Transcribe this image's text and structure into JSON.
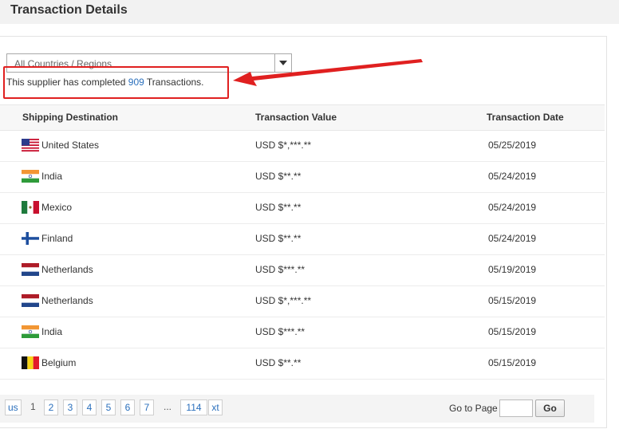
{
  "header": {
    "title": "Transaction Details"
  },
  "filter": {
    "selected": "All Countries / Regions"
  },
  "summary": {
    "prefix": "This supplier has completed",
    "count": "909",
    "suffix": "Transactions."
  },
  "table": {
    "columns": [
      "Shipping Destination",
      "Transaction Value",
      "Transaction Date"
    ],
    "rows": [
      {
        "flag": "us-flag-icon",
        "country": "United States",
        "value": "USD $*,***.**",
        "date": "05/25/2019"
      },
      {
        "flag": "india-flag-icon",
        "country": "India",
        "value": "USD $**.**",
        "date": "05/24/2019"
      },
      {
        "flag": "mexico-flag-icon",
        "country": "Mexico",
        "value": "USD $**.**",
        "date": "05/24/2019"
      },
      {
        "flag": "finland-flag-icon",
        "country": "Finland",
        "value": "USD $**.**",
        "date": "05/24/2019"
      },
      {
        "flag": "netherlands-flag-icon",
        "country": "Netherlands",
        "value": "USD $***.**",
        "date": "05/19/2019"
      },
      {
        "flag": "netherlands-flag-icon",
        "country": "Netherlands",
        "value": "USD $*,***.**",
        "date": "05/15/2019"
      },
      {
        "flag": "india-flag-icon",
        "country": "India",
        "value": "USD $***.**",
        "date": "05/15/2019"
      },
      {
        "flag": "belgium-flag-icon",
        "country": "Belgium",
        "value": "USD $**.**",
        "date": "05/15/2019"
      }
    ]
  },
  "pagination": {
    "prev": "us",
    "current": "1",
    "pages": [
      "2",
      "3",
      "4",
      "5",
      "6",
      "7"
    ],
    "ellipsis": "...",
    "last": "114",
    "next": "xt",
    "goto_label": "Go to Page",
    "goto_value": "",
    "go_label": "Go"
  }
}
